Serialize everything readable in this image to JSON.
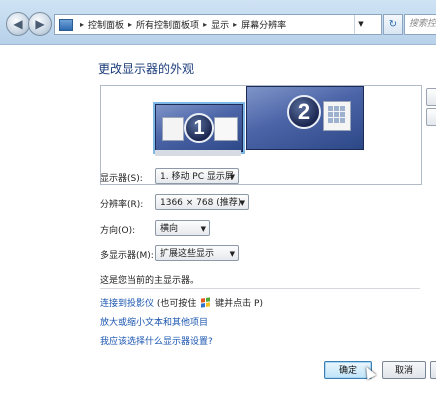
{
  "window": {
    "breadcrumb": [
      "控制面板",
      "所有控制面板项",
      "显示",
      "屏幕分辨率"
    ],
    "search_placeholder": "搜索控制"
  },
  "page": {
    "title": "更改显示器的外观"
  },
  "preview": {
    "monitors": [
      {
        "number": "1",
        "selected": true
      },
      {
        "number": "2",
        "selected": false
      }
    ]
  },
  "form": {
    "display_label": "显示器(S):",
    "display_value": "1. 移动 PC 显示屏",
    "resolution_label": "分辨率(R):",
    "resolution_value": "1366 × 768 (推荐)",
    "orientation_label": "方向(O):",
    "orientation_value": "横向",
    "multi_label": "多显示器(M):",
    "multi_value": "扩展这些显示"
  },
  "status_text": "这是您当前的主显示器。",
  "links": {
    "projector_link": "连接到投影仪",
    "projector_hint_prefix": "(也可按住",
    "projector_hint_suffix": "键并点击 P)",
    "text_size_link": "放大或缩小文本和其他项目",
    "help_link": "我应该选择什么显示器设置?"
  },
  "buttons": {
    "ok": "确定",
    "cancel": "取消"
  }
}
